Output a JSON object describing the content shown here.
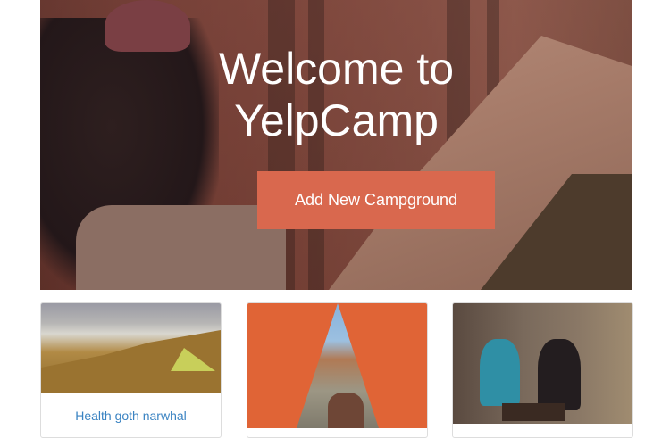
{
  "hero": {
    "title_line1": "Welcome to",
    "title_line2": "YelpCamp",
    "cta_label": "Add New Campground"
  },
  "campgrounds": [
    {
      "name": "Health goth narwhal",
      "image": "mountain-meadow-photo"
    },
    {
      "name": "",
      "image": "tent-view-photo"
    },
    {
      "name": "",
      "image": "campfire-friends-photo"
    }
  ],
  "colors": {
    "cta": "#d9684e",
    "caption_link": "#3a83c2"
  }
}
